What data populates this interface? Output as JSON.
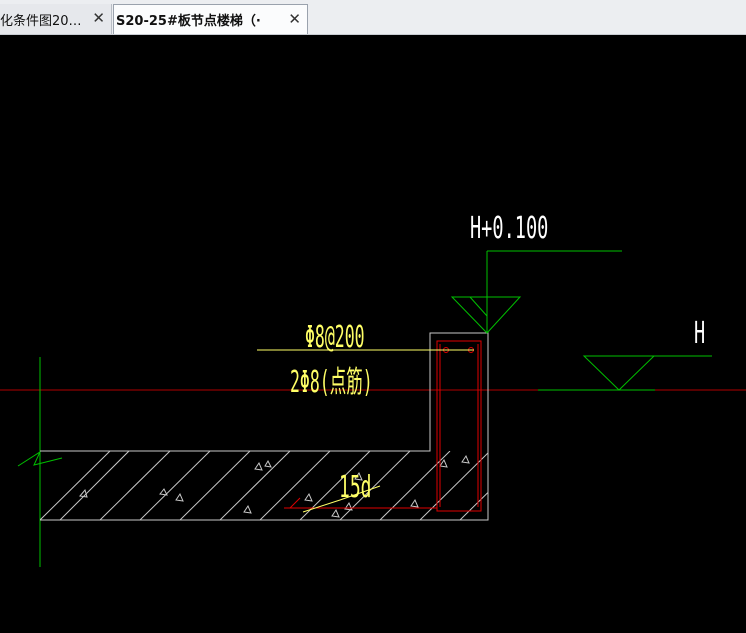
{
  "tabs": [
    {
      "label": "化条件图20…",
      "close": "✕"
    },
    {
      "label": "S20-25#板节点楼梯（·",
      "close": "✕"
    }
  ],
  "drawing": {
    "elev_top": "H+0.100",
    "elev_h": "H",
    "rebar_top": "Φ8@200",
    "rebar_bottom": "2Φ8(点筋)",
    "anchor": "15d"
  },
  "colors": {
    "bg": "#000000",
    "green": "#00c000",
    "white": "#ffffff",
    "yellow": "#ffff66",
    "red": "#e00000",
    "gray": "#c8c8c8"
  }
}
